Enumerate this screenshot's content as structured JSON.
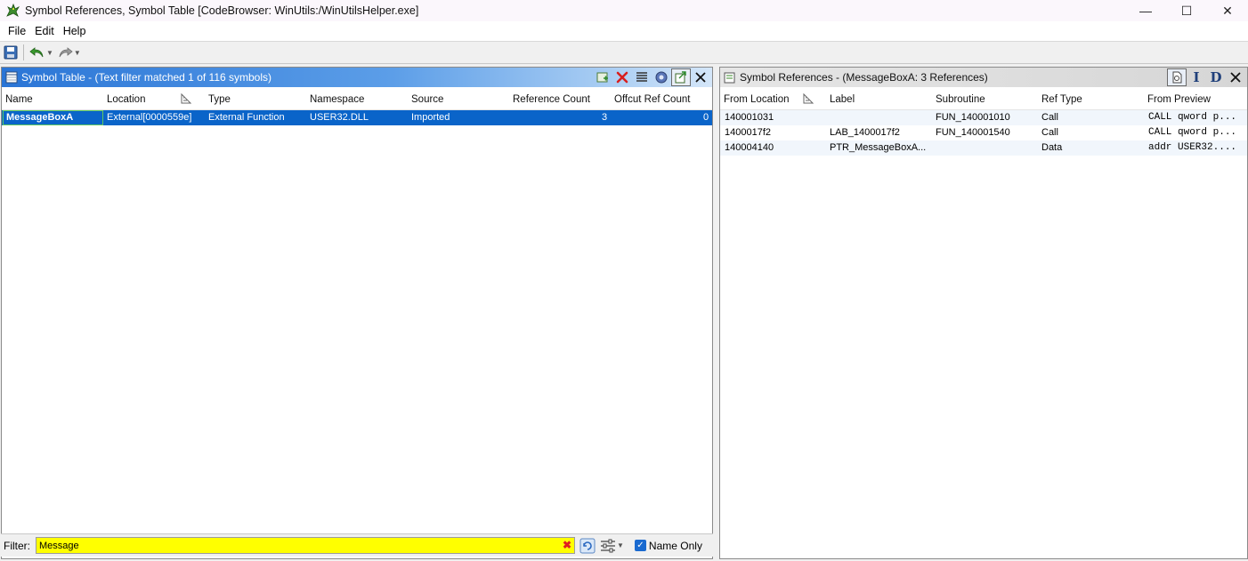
{
  "window": {
    "title": "Symbol References, Symbol Table [CodeBrowser: WinUtils:/WinUtilsHelper.exe]",
    "minimize": "—",
    "maximize": "☐",
    "close": "✕"
  },
  "menu": {
    "file": "File",
    "edit": "Edit",
    "help": "Help"
  },
  "symbol_table": {
    "title": "Symbol Table -  (Text filter matched 1 of 116 symbols)",
    "columns": {
      "name": "Name",
      "location": "Location",
      "type": "Type",
      "namespace": "Namespace",
      "source": "Source",
      "reference_count": "Reference Count",
      "offcut_ref_count": "Offcut Ref Count"
    },
    "rows": [
      {
        "name": "MessageBoxA",
        "location": "External[0000559e]",
        "type": "External Function",
        "namespace": "USER32.DLL",
        "source": "Imported",
        "reference_count": "3",
        "offcut_ref_count": "0"
      }
    ]
  },
  "filter": {
    "label": "Filter:",
    "value": "Message",
    "name_only_label": "Name Only",
    "name_only_checked": true
  },
  "symbol_refs": {
    "title": "Symbol References - (MessageBoxA: 3 References)",
    "columns": {
      "from_location": "From Location",
      "label": "Label",
      "subroutine": "Subroutine",
      "ref_type": "Ref Type",
      "from_preview": "From Preview"
    },
    "rows": [
      {
        "from_location": "140001031",
        "label": "",
        "subroutine": "FUN_140001010",
        "ref_type": "Call",
        "from_preview": "CALL qword p..."
      },
      {
        "from_location": "1400017f2",
        "label": "LAB_1400017f2",
        "subroutine": "FUN_140001540",
        "ref_type": "Call",
        "from_preview": "CALL qword p..."
      },
      {
        "from_location": "140004140",
        "label": "PTR_MessageBoxA...",
        "subroutine": "",
        "ref_type": "Data",
        "from_preview": "addr USER32...."
      }
    ]
  }
}
